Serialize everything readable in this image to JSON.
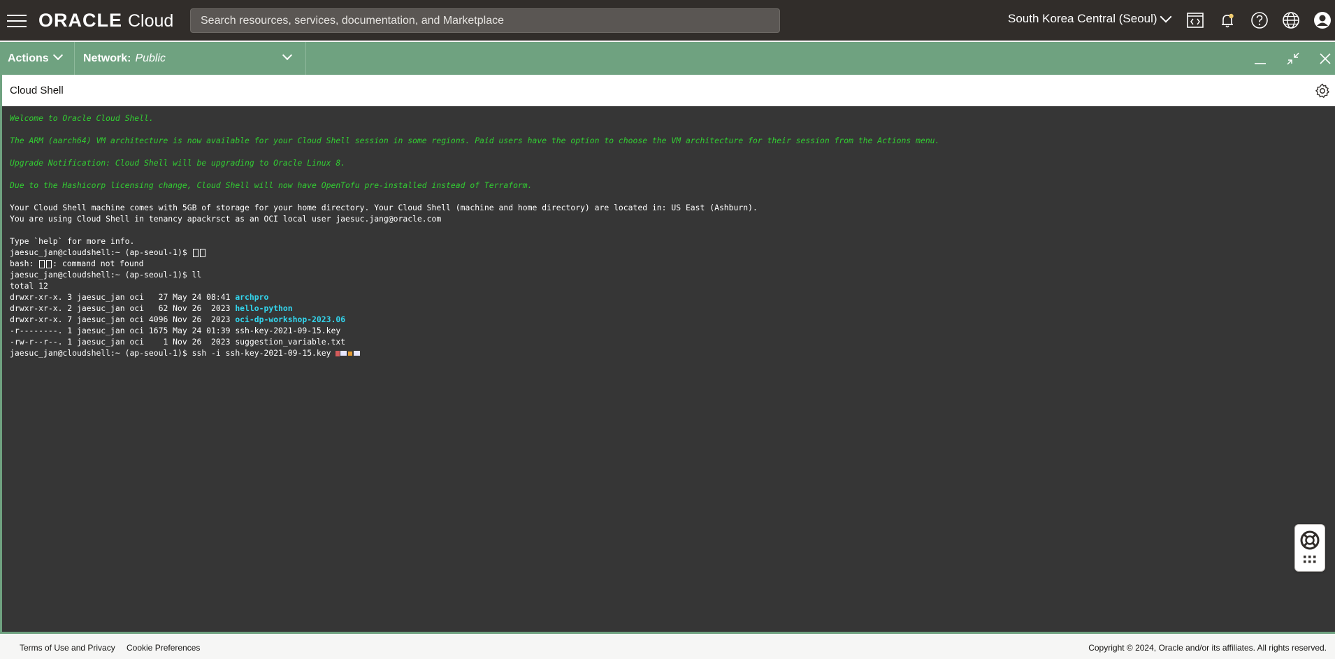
{
  "header": {
    "brand": "ORACLE",
    "product": "Cloud",
    "search_placeholder": "Search resources, services, documentation, and Marketplace",
    "region": "South Korea Central (Seoul)"
  },
  "actionbar": {
    "actions_label": "Actions",
    "network_label": "Network:",
    "network_value": "Public"
  },
  "shell": {
    "title": "Cloud Shell"
  },
  "terminal": {
    "welcome": "Welcome to Oracle Cloud Shell.",
    "arm_notice": "The ARM (aarch64) VM architecture is now available for your Cloud Shell session in some regions. Paid users have the option to choose the VM architecture for their session from the Actions menu.",
    "upgrade_notice": "Upgrade Notification: Cloud Shell will be upgrading to Oracle Linux 8.",
    "hashicorp_notice": "Due to the Hashicorp licensing change, Cloud Shell will now have OpenTofu pre-installed instead of Terraform.",
    "storage_info": "Your Cloud Shell machine comes with 5GB of storage for your home directory. Your Cloud Shell (machine and home directory) are located in: US East (Ashburn).",
    "tenancy_info": "You are using Cloud Shell in tenancy apackrsct as an OCI local user jaesuc.jang@oracle.com",
    "help_info": "Type `help` for more info.",
    "prompt": "jaesuc_jan@cloudshell:~ (ap-seoul-1)$ ",
    "bash_prefix": "bash: ",
    "bash_suffix": ": command not found",
    "cmd_ll": "ll",
    "total": "total 12",
    "listing": [
      {
        "meta": "drwxr-xr-x. 3 jaesuc_jan oci   27 May 24 08:41 ",
        "name": "archpro",
        "dir": true
      },
      {
        "meta": "drwxr-xr-x. 2 jaesuc_jan oci   62 Nov 26  2023 ",
        "name": "hello-python",
        "dir": true
      },
      {
        "meta": "drwxr-xr-x. 7 jaesuc_jan oci 4096 Nov 26  2023 ",
        "name": "oci-dp-workshop-2023.06",
        "dir": true
      },
      {
        "meta": "-r--------. 1 jaesuc_jan oci 1675 May 24 01:39 ",
        "name": "ssh-key-2021-09-15.key",
        "dir": false
      },
      {
        "meta": "-rw-r--r--. 1 jaesuc_jan oci    1 Nov 26  2023 ",
        "name": "suggestion_variable.txt",
        "dir": false
      }
    ],
    "cmd_ssh": "ssh -i ssh-key-2021-09-15.key "
  },
  "footer": {
    "terms": "Terms of Use and Privacy",
    "cookies": "Cookie Preferences",
    "copyright": "Copyright © 2024, Oracle and/or its affiliates. All rights reserved."
  },
  "colors": {
    "topbar": "#312d2a",
    "accent_green": "#6fa280",
    "terminal_bg": "#363636",
    "notice_green": "#32cd32",
    "dir_cyan": "#33d6ee"
  },
  "icons": [
    "menu-icon",
    "code-editor-icon",
    "bell-icon",
    "help-icon",
    "globe-icon",
    "user-icon",
    "minimize-icon",
    "restore-icon",
    "close-icon",
    "gear-icon",
    "lifebuoy-icon",
    "grid-icon"
  ]
}
